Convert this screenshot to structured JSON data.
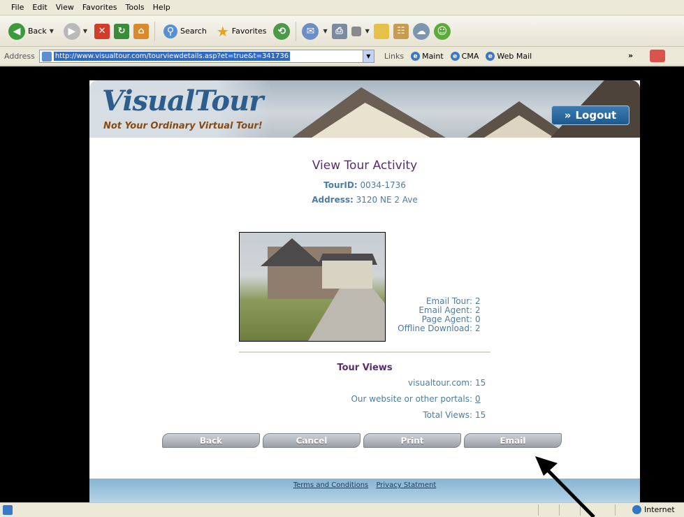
{
  "menu": [
    "File",
    "Edit",
    "View",
    "Favorites",
    "Tools",
    "Help"
  ],
  "toolbar": {
    "back_label": "Back",
    "search_label": "Search",
    "favorites_label": "Favorites"
  },
  "address": {
    "label": "Address",
    "url": "http://www.visualtour.com/tourviewdetails.asp?et=true&t=341736",
    "links_label": "Links",
    "links": [
      "Maint",
      "CMA",
      "Web Mail"
    ]
  },
  "page": {
    "logo_text": "VisualTour",
    "tagline": "Not Your Ordinary Virtual Tour!",
    "logout_label": "Logout",
    "title": "View Tour Activity",
    "tour_id_label": "TourID:",
    "tour_id": "0034-1736",
    "address_label": "Address:",
    "address_value": "3120 NE 2 Ave",
    "stats": [
      {
        "label": "Email Tour:",
        "value": "2"
      },
      {
        "label": "Email Agent:",
        "value": "2"
      },
      {
        "label": "Page Agent:",
        "value": "0"
      },
      {
        "label": "Offline Download:",
        "value": "2"
      }
    ],
    "views_title": "Tour Views",
    "views": [
      {
        "label": "visualtour.com:",
        "value": "15"
      },
      {
        "label": "Our website or other portals:",
        "value": "0"
      },
      {
        "label": "Total Views:",
        "value": "15"
      }
    ],
    "buttons": [
      "Back",
      "Cancel",
      "Print",
      "Email"
    ],
    "footer_links": [
      "Terms and Conditions",
      "Privacy Statment"
    ]
  },
  "status": {
    "zone": "Internet"
  }
}
